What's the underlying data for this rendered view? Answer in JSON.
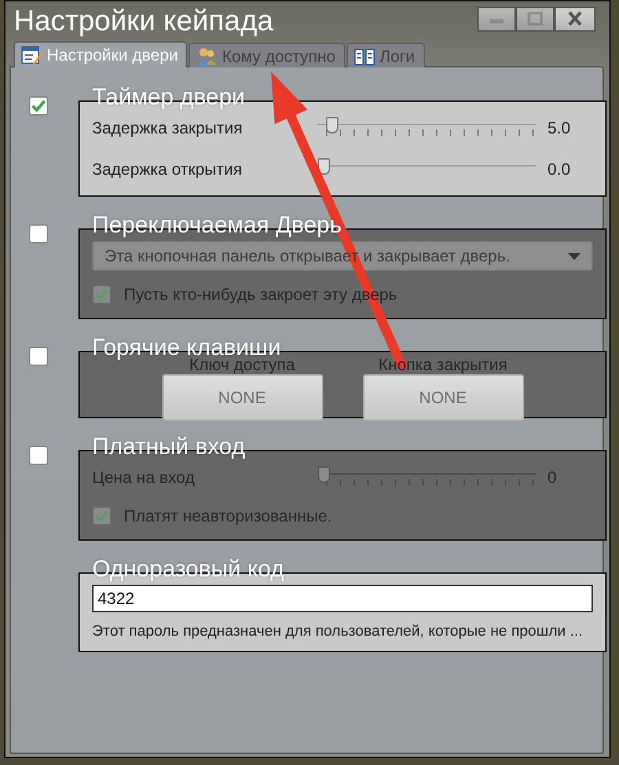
{
  "window": {
    "title": "Настройки кейпада",
    "controls": [
      {
        "kind": "minimize",
        "disabled": true
      },
      {
        "kind": "maximize",
        "disabled": true
      },
      {
        "kind": "close",
        "disabled": false
      }
    ]
  },
  "tabs": [
    {
      "kind": "settings",
      "label": "Настройки двери",
      "selected": true
    },
    {
      "kind": "access",
      "label": "Кому доступно",
      "selected": false
    },
    {
      "kind": "logs",
      "label": "Логи",
      "selected": false
    }
  ],
  "sections": [
    {
      "kind": "timer",
      "title": "Таймер двери",
      "checked": true,
      "sliders": [
        {
          "label": "Задержка закрытия",
          "level": 0.04,
          "reading": "5.0"
        },
        {
          "label": "Задержка открытия",
          "level": 0,
          "reading": "0.0"
        }
      ]
    },
    {
      "kind": "toggle",
      "title": "Переключаемая Дверь",
      "checked": false,
      "dropdown": {
        "value": "Эта кнопочная панель открывает и закрывает дверь."
      },
      "option": {
        "label": "Пусть кто-нибудь закроет эту дверь",
        "checked": true
      }
    },
    {
      "kind": "hotkeys",
      "title": "Горячие клавиши",
      "checked": false,
      "keys": [
        {
          "label": "Ключ доступа",
          "value": "NONE"
        },
        {
          "label": "Кнопка закрытия",
          "value": "NONE"
        }
      ]
    },
    {
      "kind": "paid",
      "title": "Платный вход",
      "checked": false,
      "sliders": [
        {
          "label": "Цена на вход",
          "level": 0,
          "reading": "0"
        }
      ],
      "option": {
        "label": "Платят неавторизованные.",
        "checked": true
      }
    },
    {
      "kind": "code",
      "title": "Одноразовый код",
      "value": "4322",
      "note": "Этот пароль предназначен для пользователей, которые не прошли ..."
    }
  ]
}
